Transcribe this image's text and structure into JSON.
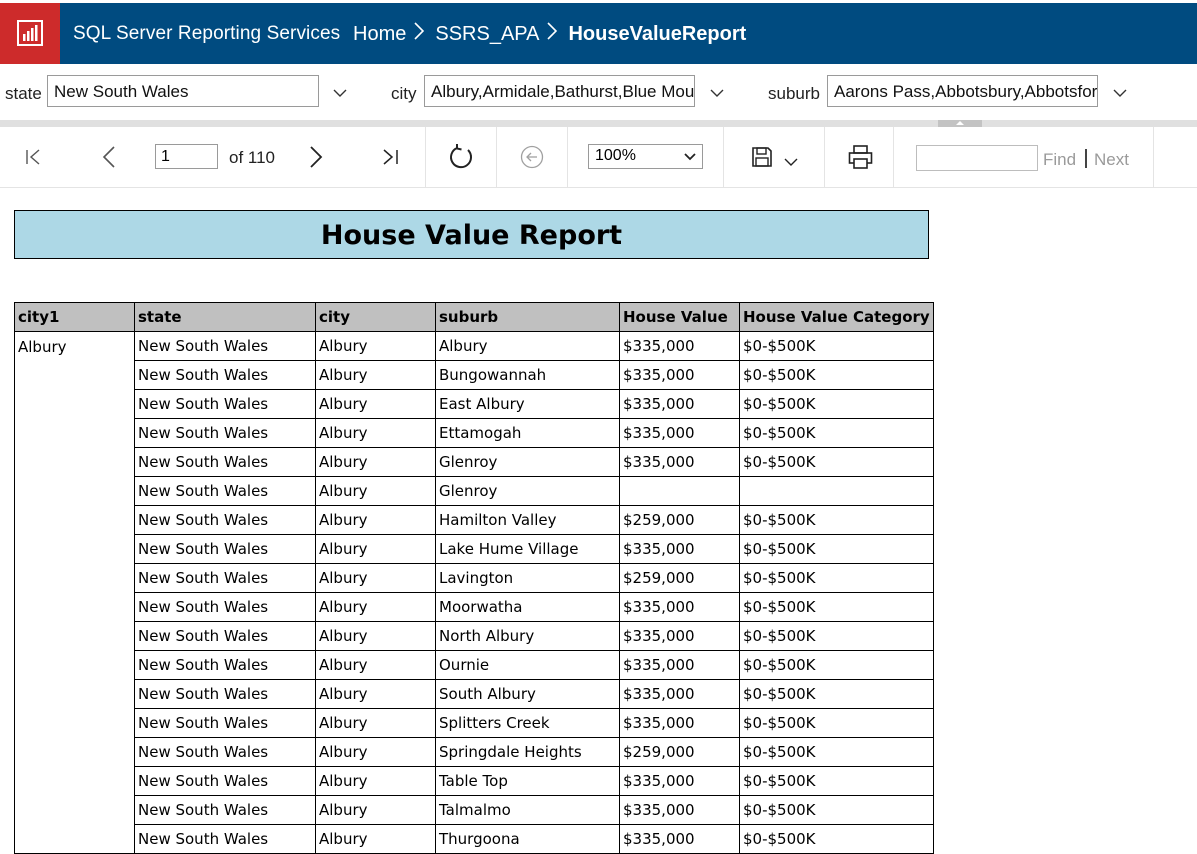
{
  "header": {
    "app_title": "SQL Server Reporting Services",
    "breadcrumbs": [
      "Home",
      "SSRS_APA",
      "HouseValueReport"
    ]
  },
  "params": {
    "state": {
      "label": "state",
      "value": "New South Wales"
    },
    "city": {
      "label": "city",
      "value": "Albury,Armidale,Bathurst,Blue Mountains"
    },
    "suburb": {
      "label": "suburb",
      "value": "Aarons Pass,Abbotsbury,Abbotsford"
    }
  },
  "toolbar": {
    "page": "1",
    "of_text": "of 110",
    "zoom": "100%",
    "zoom_options": [
      "100%"
    ],
    "find_label": "Find",
    "next_label": "Next"
  },
  "report": {
    "title": "House Value Report",
    "columns": [
      "city1",
      "state",
      "city",
      "suburb",
      "House Value",
      "House Value Category"
    ],
    "group_city": "Albury",
    "rows": [
      {
        "state": "New South Wales",
        "city": "Albury",
        "suburb": "Albury",
        "value": "$335,000",
        "category": "$0-$500K"
      },
      {
        "state": "New South Wales",
        "city": "Albury",
        "suburb": "Bungowannah",
        "value": "$335,000",
        "category": "$0-$500K"
      },
      {
        "state": "New South Wales",
        "city": "Albury",
        "suburb": "East Albury",
        "value": "$335,000",
        "category": "$0-$500K"
      },
      {
        "state": "New South Wales",
        "city": "Albury",
        "suburb": "Ettamogah",
        "value": "$335,000",
        "category": "$0-$500K"
      },
      {
        "state": "New South Wales",
        "city": "Albury",
        "suburb": "Glenroy",
        "value": "$335,000",
        "category": "$0-$500K"
      },
      {
        "state": "New South Wales",
        "city": "Albury",
        "suburb": "Glenroy",
        "value": "",
        "category": ""
      },
      {
        "state": "New South Wales",
        "city": "Albury",
        "suburb": "Hamilton Valley",
        "value": "$259,000",
        "category": "$0-$500K"
      },
      {
        "state": "New South Wales",
        "city": "Albury",
        "suburb": "Lake Hume Village",
        "value": "$335,000",
        "category": "$0-$500K"
      },
      {
        "state": "New South Wales",
        "city": "Albury",
        "suburb": "Lavington",
        "value": "$259,000",
        "category": "$0-$500K"
      },
      {
        "state": "New South Wales",
        "city": "Albury",
        "suburb": "Moorwatha",
        "value": "$335,000",
        "category": "$0-$500K"
      },
      {
        "state": "New South Wales",
        "city": "Albury",
        "suburb": "North Albury",
        "value": "$335,000",
        "category": "$0-$500K"
      },
      {
        "state": "New South Wales",
        "city": "Albury",
        "suburb": "Ournie",
        "value": "$335,000",
        "category": "$0-$500K"
      },
      {
        "state": "New South Wales",
        "city": "Albury",
        "suburb": "South Albury",
        "value": "$335,000",
        "category": "$0-$500K"
      },
      {
        "state": "New South Wales",
        "city": "Albury",
        "suburb": "Splitters Creek",
        "value": "$335,000",
        "category": "$0-$500K"
      },
      {
        "state": "New South Wales",
        "city": "Albury",
        "suburb": "Springdale Heights",
        "value": "$259,000",
        "category": "$0-$500K"
      },
      {
        "state": "New South Wales",
        "city": "Albury",
        "suburb": "Table Top",
        "value": "$335,000",
        "category": "$0-$500K"
      },
      {
        "state": "New South Wales",
        "city": "Albury",
        "suburb": "Talmalmo",
        "value": "$335,000",
        "category": "$0-$500K"
      },
      {
        "state": "New South Wales",
        "city": "Albury",
        "suburb": "Thurgoona",
        "value": "$335,000",
        "category": "$0-$500K"
      }
    ]
  }
}
